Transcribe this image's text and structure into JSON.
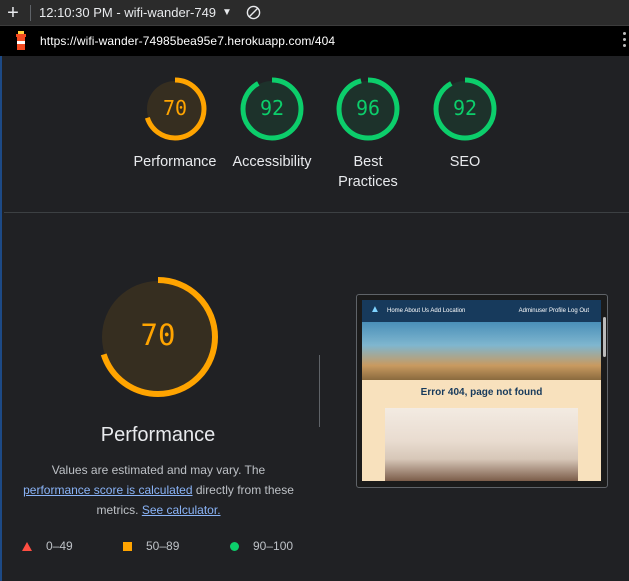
{
  "topbar": {
    "time_title": "12:10:30 PM - wifi-wander-749",
    "new_tab": "+"
  },
  "urlbar": {
    "url": "https://wifi-wander-74985bea95e7.herokuapp.com/404"
  },
  "scores": [
    {
      "label": "Performance",
      "value": 70,
      "color": "#ffa400"
    },
    {
      "label": "Accessibility",
      "value": 92,
      "color": "#0cce6b"
    },
    {
      "label": "Best Practices",
      "value": 96,
      "color": "#0cce6b"
    },
    {
      "label": "SEO",
      "value": 92,
      "color": "#0cce6b"
    }
  ],
  "main": {
    "score": 70,
    "title": "Performance",
    "desc_1": "Values are estimated and may vary. The",
    "desc_link": "performance score is calculated",
    "desc_2": " directly from these metrics.",
    "desc_link2": "See calculator.",
    "color": "#ffa400"
  },
  "legend": {
    "low": "0–49",
    "mid": "50–89",
    "high": "90–100"
  },
  "screenshot": {
    "nav_links": "Home  About Us  Add Location",
    "nav_right": "Adminuser  Profile  Log Out",
    "error_text": "Error 404, page not found"
  }
}
